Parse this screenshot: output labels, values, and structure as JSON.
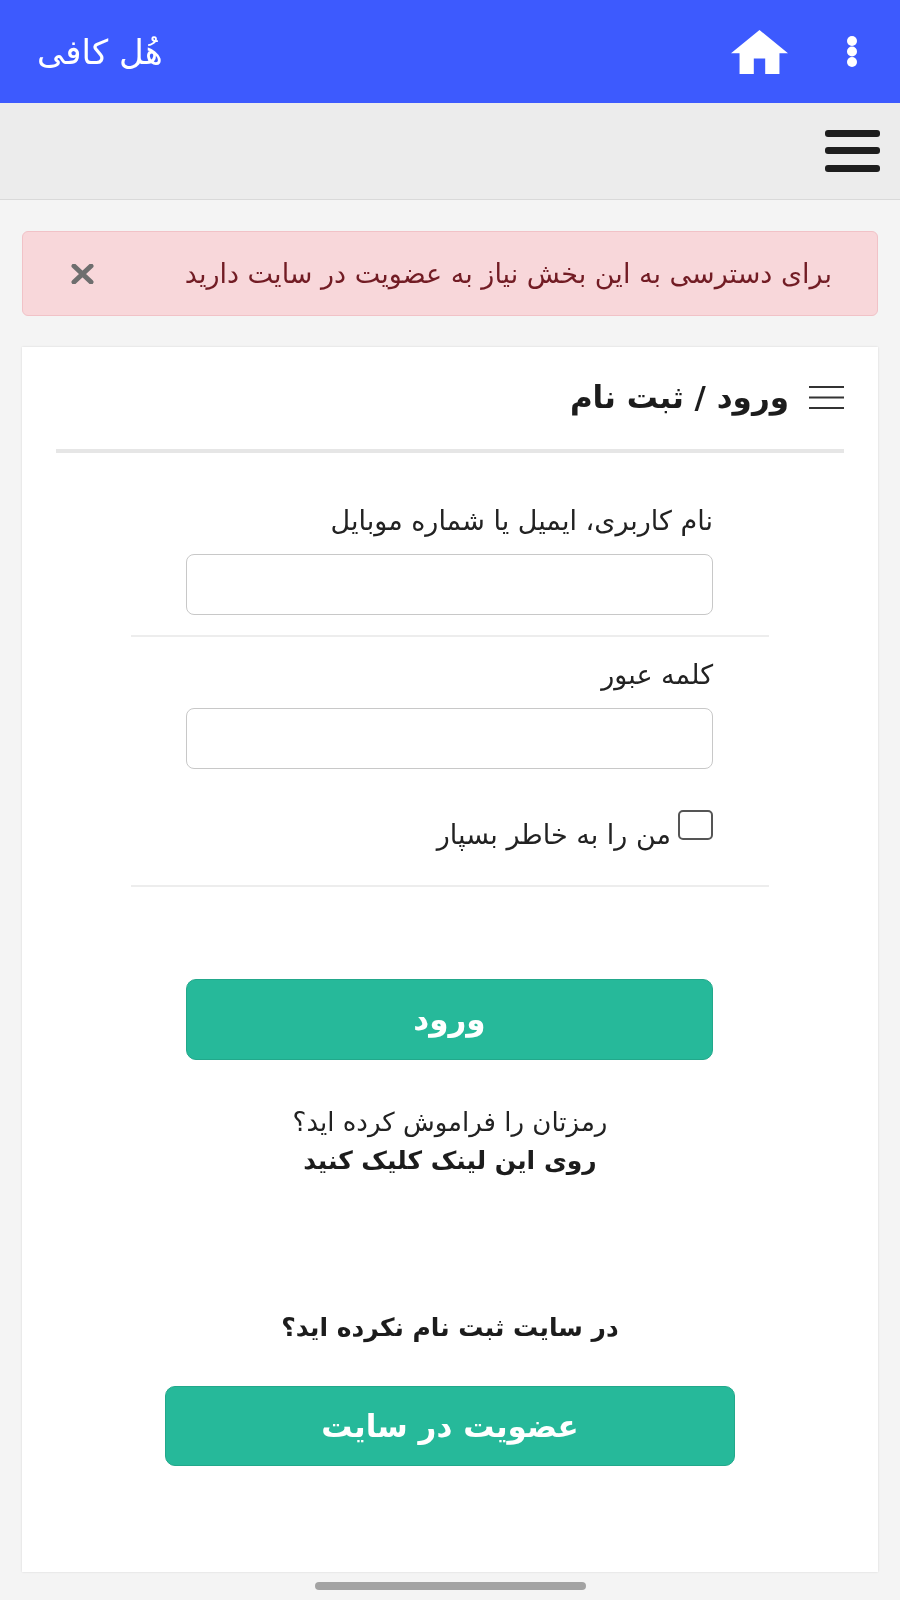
{
  "app_bar": {
    "title": "هُل کافی"
  },
  "alert": {
    "message": "برای دسترسی به این بخش نیاز به عضویت در سایت دارید"
  },
  "card": {
    "title": "ورود / ثبت نام"
  },
  "form": {
    "fields": [
      {
        "label": "نام کاربری، ایمیل یا شماره موبایل"
      },
      {
        "label": "کلمه عبور"
      }
    ],
    "remember": {
      "label": "من را به خاطر بسپار",
      "checked": false
    },
    "submit": "ورود"
  },
  "forgot": {
    "question": "رمزتان را فراموش کرده اید؟",
    "link": "روی این لینک کلیک کنید"
  },
  "signup": {
    "question": "در سایت ثبت نام نکرده اید؟",
    "button": "عضویت در سایت"
  }
}
